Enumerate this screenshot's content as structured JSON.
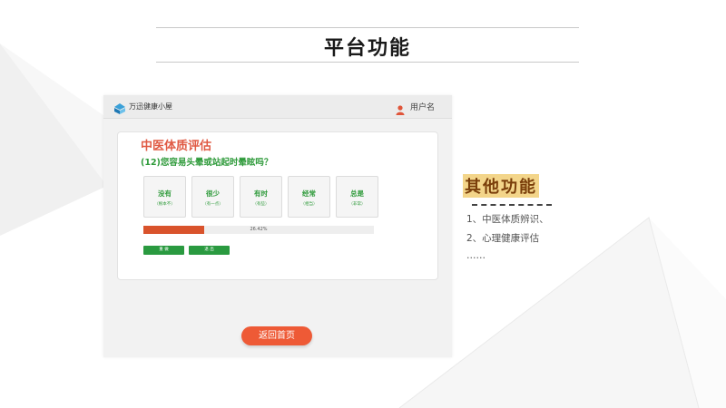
{
  "slide": {
    "title": "平台功能"
  },
  "app": {
    "name": "万迅健康小屋",
    "user": "用户名",
    "card_title": "中医体质评估",
    "question": "(12)您容易头晕或站起时晕眩吗？",
    "options": [
      {
        "label": "没有",
        "sub": "（根本不）"
      },
      {
        "label": "很少",
        "sub": "（有一点）"
      },
      {
        "label": "有时",
        "sub": "（有些）"
      },
      {
        "label": "经常",
        "sub": "（相当）"
      },
      {
        "label": "总是",
        "sub": "（非常）"
      }
    ],
    "progress": {
      "value": 26.42,
      "label": "26.42%"
    },
    "buttons": {
      "prev": "重 做",
      "next": "退 出"
    },
    "home_button": "返回首页"
  },
  "other": {
    "title": "其他功能",
    "features": [
      "1、中医体质辨识、",
      "2、心理健康评估",
      "……"
    ]
  },
  "colors": {
    "accent_red": "#e05a44",
    "green": "#2e9a3a",
    "orange_button": "#ee5a36",
    "progress": "#d9532c"
  }
}
